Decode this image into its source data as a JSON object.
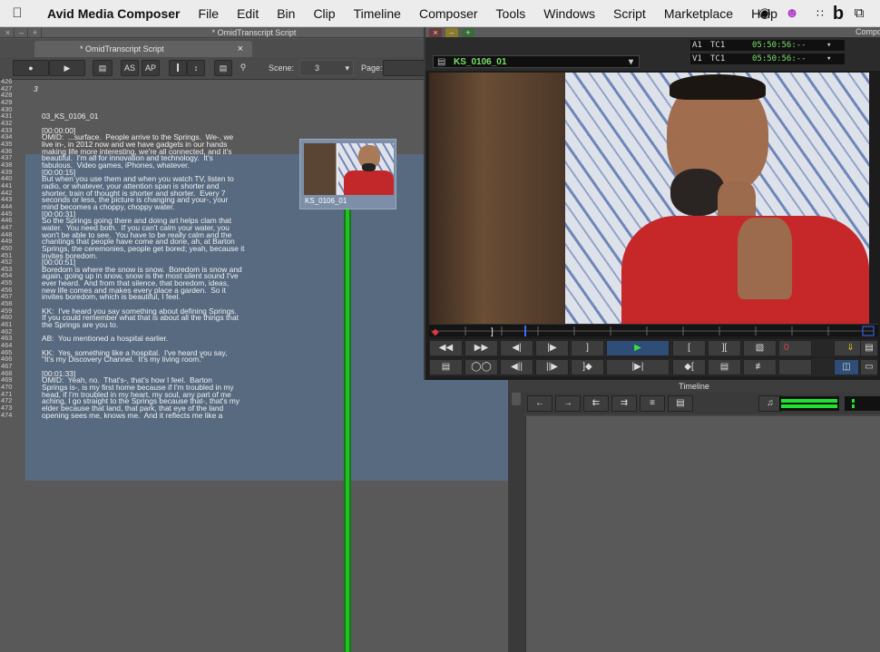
{
  "menubar": {
    "app_name": "Avid Media Composer",
    "items": [
      "File",
      "Edit",
      "Bin",
      "Clip",
      "Timeline",
      "Composer",
      "Tools",
      "Windows",
      "Script",
      "Marketplace",
      "Help"
    ],
    "status_icons": [
      "creative-cloud-icon",
      "app-icon-pink",
      "grid-icon",
      "b-icon",
      "window-icon"
    ]
  },
  "script_window": {
    "title": "* OmidTranscript Script",
    "tab_label": "* OmidTranscript Script",
    "toolbar": {
      "as_label": "AS",
      "ap_label": "AP",
      "scene_label": "Scene:",
      "scene_value": "3",
      "page_label": "Page:",
      "page_value": ""
    },
    "clip_thumb_label": "KS_0106_01",
    "lines": [
      {
        "n": "426",
        "t": ""
      },
      {
        "n": "427",
        "t": "3"
      },
      {
        "n": "428",
        "t": ""
      },
      {
        "n": "429",
        "t": ""
      },
      {
        "n": "430",
        "t": ""
      },
      {
        "n": "431",
        "t": "03_KS_0106_01"
      },
      {
        "n": "432",
        "t": ""
      },
      {
        "n": "433",
        "t": "[00:00:00]"
      },
      {
        "n": "434",
        "t": "OMID:  ...surface.  People arrive to the Springs.  We-, we"
      },
      {
        "n": "435",
        "t": "live in-, in 2012 now and we have gadgets in our hands"
      },
      {
        "n": "436",
        "t": "making life more interesting, we're all connected, and it's"
      },
      {
        "n": "437",
        "t": "beautiful.  I'm all for innovation and technology.  It's"
      },
      {
        "n": "438",
        "t": "fabulous.  Video games, iPhones, whatever."
      },
      {
        "n": "439",
        "t": "[00:00:15]"
      },
      {
        "n": "440",
        "t": "But when you use them and when you watch TV, listen to"
      },
      {
        "n": "441",
        "t": "radio, or whatever, your attention span is shorter and"
      },
      {
        "n": "442",
        "t": "shorter, train of thought is shorter and shorter.  Every 7"
      },
      {
        "n": "443",
        "t": "seconds or less, the picture is changing and your-, your"
      },
      {
        "n": "444",
        "t": "mind becomes a choppy, choppy water."
      },
      {
        "n": "445",
        "t": "[00:00:31]"
      },
      {
        "n": "446",
        "t": "So the Springs going there and doing art helps clam that"
      },
      {
        "n": "447",
        "t": "water.  You need both.  If you can't calm your water, you"
      },
      {
        "n": "448",
        "t": "won't be able to see.  You have to be really calm and the"
      },
      {
        "n": "449",
        "t": "chantings that people have come and done, ah, at Barton"
      },
      {
        "n": "450",
        "t": "Springs, the ceremonies, people get bored; yeah, because it"
      },
      {
        "n": "451",
        "t": "invites boredom."
      },
      {
        "n": "452",
        "t": "[00:00:51]"
      },
      {
        "n": "453",
        "t": "Boredom is where the snow is snow.  Boredom is snow and"
      },
      {
        "n": "454",
        "t": "again, going up in snow, snow is the most silent sound I've"
      },
      {
        "n": "455",
        "t": "ever heard.  And from that silence, that boredom, ideas,"
      },
      {
        "n": "456",
        "t": "new life comes and makes every place a garden.  So it"
      },
      {
        "n": "457",
        "t": "invites boredom, which is beautiful, I feel."
      },
      {
        "n": "458",
        "t": ""
      },
      {
        "n": "459",
        "t": "KK:  I've heard you say something about defining Springs."
      },
      {
        "n": "460",
        "t": "If you could remember what that is about all the things that"
      },
      {
        "n": "461",
        "t": "the Springs are you to."
      },
      {
        "n": "462",
        "t": ""
      },
      {
        "n": "463",
        "t": "AB:  You mentioned a hospital earlier."
      },
      {
        "n": "464",
        "t": ""
      },
      {
        "n": "465",
        "t": "KK:  Yes, something like a hospital.  I've heard you say,"
      },
      {
        "n": "466",
        "t": "\"It's my Discovery Channel.  It's my living room.\""
      },
      {
        "n": "467",
        "t": ""
      },
      {
        "n": "468",
        "t": "[00:01:33]"
      },
      {
        "n": "469",
        "t": "OMID:  Yeah, no.  That's-, that's how I feel.  Barton"
      },
      {
        "n": "470",
        "t": "Springs is-, is my first home because if I'm troubled in my"
      },
      {
        "n": "471",
        "t": "head, if I'm troubled in my heart, my soul, any part of me"
      },
      {
        "n": "472",
        "t": "aching, I go straight to the Springs because that-, that's my"
      },
      {
        "n": "473",
        "t": "elder because that land, that park, that eye of the land"
      },
      {
        "n": "474",
        "t": "opening sees me, knows me.  And it reflects me like a"
      }
    ]
  },
  "composer": {
    "title": "Compo",
    "clip_name": "KS_0106_01",
    "tc_rows": [
      {
        "track": "A1",
        "type": "TC1",
        "value": "05:50:56:--"
      },
      {
        "track": "V1",
        "type": "TC1",
        "value": "05:50:56:--"
      }
    ],
    "mark_value": "0"
  },
  "timeline": {
    "title": "Timeline"
  },
  "colors": {
    "tc_green": "#7ae06b",
    "script_highlight": "#576a80",
    "sync_line": "#22c025"
  }
}
